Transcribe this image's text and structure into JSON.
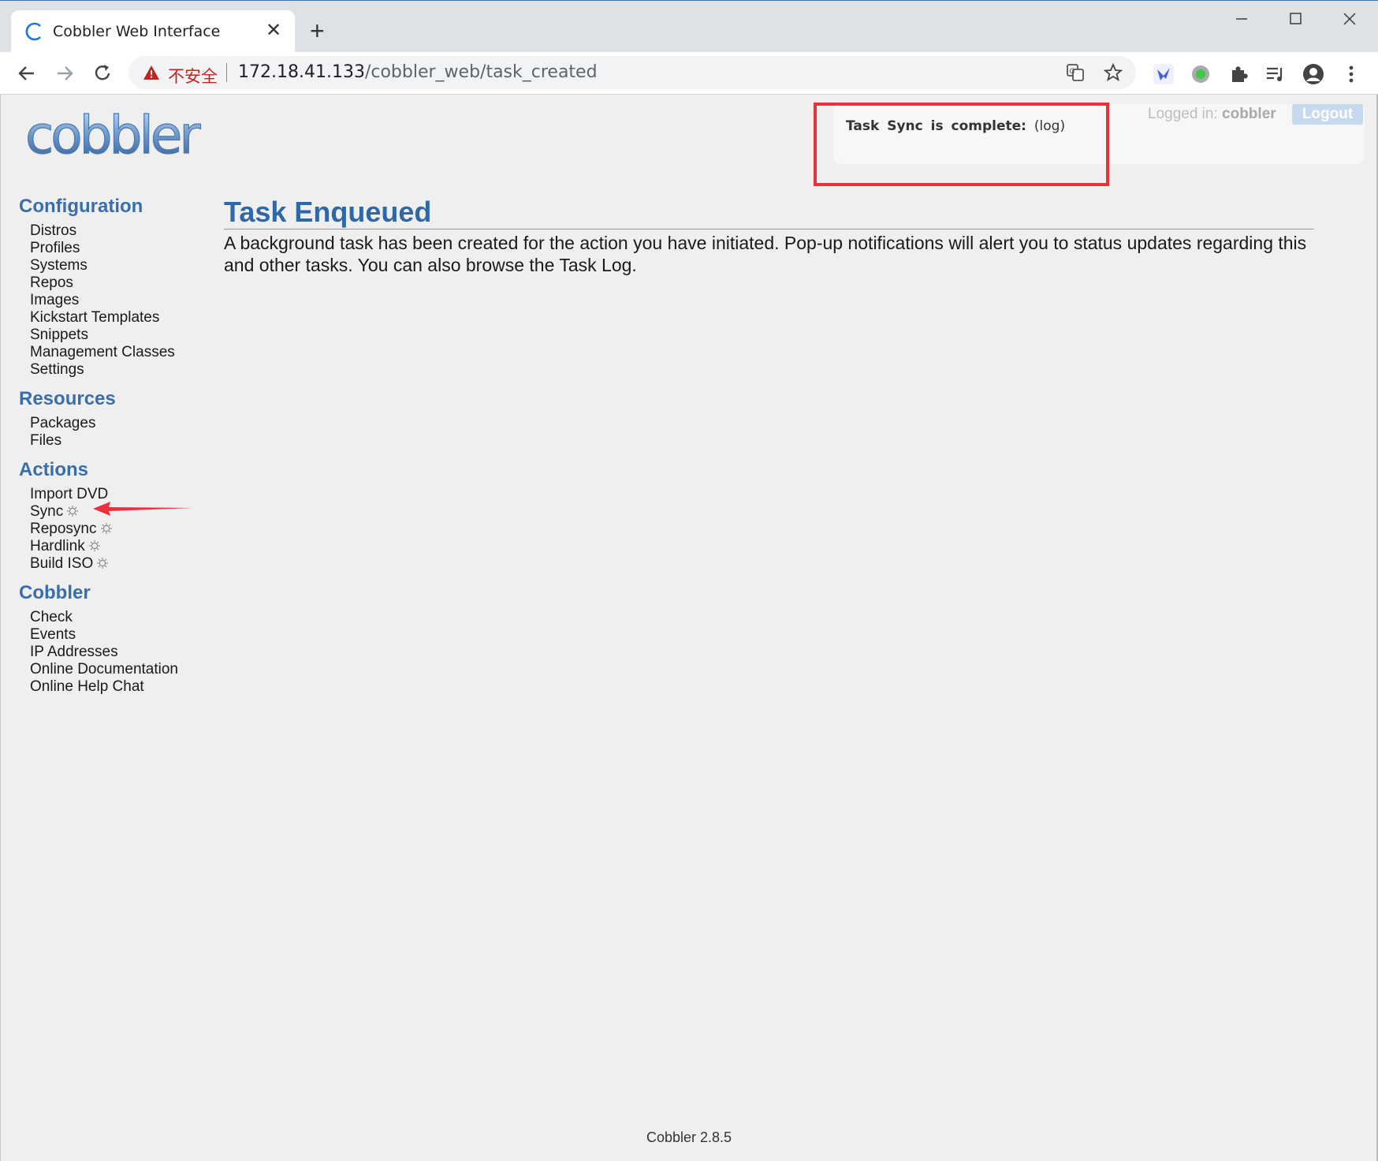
{
  "browser": {
    "tab_title": "Cobbler Web Interface",
    "tab_close": "✕",
    "new_tab": "+",
    "security_label": "不安全",
    "url_host": "172.18.41.133",
    "url_path": "/cobbler_web/task_created",
    "icons": [
      "back-icon",
      "forward-icon",
      "reload-icon",
      "translate-icon",
      "star-icon",
      "extension-icon",
      "profile-icon",
      "menu-icon"
    ]
  },
  "header": {
    "notification": {
      "prefix": "Task Sync is complete:",
      "link": "(log)"
    },
    "logged_in_label": "Logged in:",
    "username": "cobbler",
    "logout_label": "Logout"
  },
  "sidebar": {
    "sections": [
      {
        "title": "Configuration",
        "items": [
          "Distros",
          "Profiles",
          "Systems",
          "Repos",
          "Images",
          "Kickstart Templates",
          "Snippets",
          "Management Classes",
          "Settings"
        ]
      },
      {
        "title": "Resources",
        "items": [
          "Packages",
          "Files"
        ]
      },
      {
        "title": "Actions",
        "items": [
          "Import DVD",
          "Sync",
          "Reposync",
          "Hardlink",
          "Build ISO"
        ]
      },
      {
        "title": "Cobbler",
        "items": [
          "Check",
          "Events",
          "IP Addresses",
          "Online Documentation",
          "Online Help Chat"
        ]
      }
    ]
  },
  "main": {
    "heading": "Task Enqueued",
    "description": "A background task has been created for the action you have initiated. Pop-up notifications will alert you to status updates regarding this and other tasks. You can also browse the Task Log."
  },
  "footer": {
    "version": "Cobbler 2.8.5"
  },
  "colors": {
    "heading": "#2f68a8",
    "annotation": "#ec2f3d",
    "background": "#efefef"
  }
}
